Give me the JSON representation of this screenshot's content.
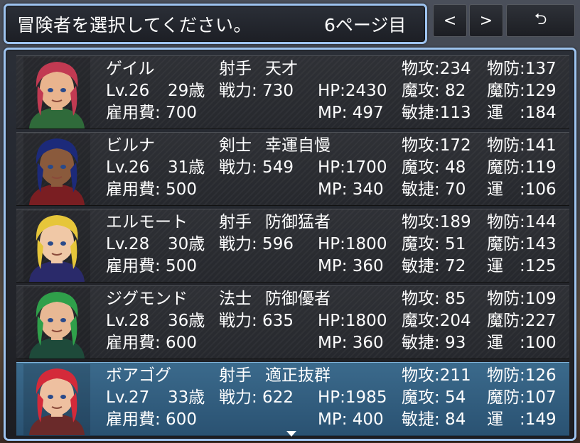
{
  "header": {
    "prompt": "冒険者を選択してください。",
    "page": "6ページ目"
  },
  "nav": {
    "prev": "<",
    "next": ">",
    "back": "⮌"
  },
  "adventurers": [
    {
      "name": "ゲイル",
      "level": "Lv.26",
      "age": "29歳",
      "cls": "射手",
      "trait": "天才",
      "power": "戦力: 730",
      "hp": "HP:2430",
      "mp": "MP: 497",
      "fee": "雇用費: 700",
      "atk": "物攻:234",
      "def": "物防:137",
      "matk": "魔攻: 82",
      "mdef": "魔防:129",
      "agi": "敏捷:113",
      "luck": "運　:184",
      "hair": "#c23a52",
      "skin": "#e9b48e",
      "cloth": "#2f6a3a"
    },
    {
      "name": "ビルナ",
      "level": "Lv.26",
      "age": "31歳",
      "cls": "剣士",
      "trait": "幸運自慢",
      "power": "戦力: 549",
      "hp": "HP:1700",
      "mp": "MP: 340",
      "fee": "雇用費: 500",
      "atk": "物攻:172",
      "def": "物防:141",
      "matk": "魔攻: 48",
      "mdef": "魔防:119",
      "agi": "敏捷: 70",
      "luck": "運　:106",
      "hair": "#1c2a7a",
      "skin": "#8a5a3c",
      "cloth": "#7a1e22"
    },
    {
      "name": "エルモート",
      "level": "Lv.28",
      "age": "30歳",
      "cls": "射手",
      "trait": "防御猛者",
      "power": "戦力: 596",
      "hp": "HP:1800",
      "mp": "MP: 360",
      "fee": "雇用費: 500",
      "atk": "物攻:189",
      "def": "物防:144",
      "matk": "魔攻: 51",
      "mdef": "魔防:143",
      "agi": "敏捷: 72",
      "luck": "運　:125",
      "hair": "#e6c63a",
      "skin": "#f0c8a6",
      "cloth": "#2a2a6a"
    },
    {
      "name": "ジグモンド",
      "level": "Lv.28",
      "age": "36歳",
      "cls": "法士",
      "trait": "防御優者",
      "power": "戦力: 635",
      "hp": "HP:1800",
      "mp": "MP: 360",
      "fee": "雇用費: 600",
      "atk": "物攻: 85",
      "def": "物防:109",
      "matk": "魔攻:204",
      "mdef": "魔防:227",
      "agi": "敏捷: 93",
      "luck": "運　:100",
      "hair": "#2fa04a",
      "skin": "#e8b894",
      "cloth": "#1e4a3a"
    },
    {
      "name": "ボアゴグ",
      "level": "Lv.27",
      "age": "33歳",
      "cls": "射手",
      "trait": "適正抜群",
      "power": "戦力: 622",
      "hp": "HP:1985",
      "mp": "MP: 400",
      "fee": "雇用費: 600",
      "atk": "物攻:211",
      "def": "物防:126",
      "matk": "魔攻: 54",
      "mdef": "魔防:107",
      "agi": "敏捷: 84",
      "luck": "運　:149",
      "hair": "#d42a3a",
      "skin": "#eec0a0",
      "cloth": "#6a2a2a"
    }
  ],
  "selected_index": 4
}
